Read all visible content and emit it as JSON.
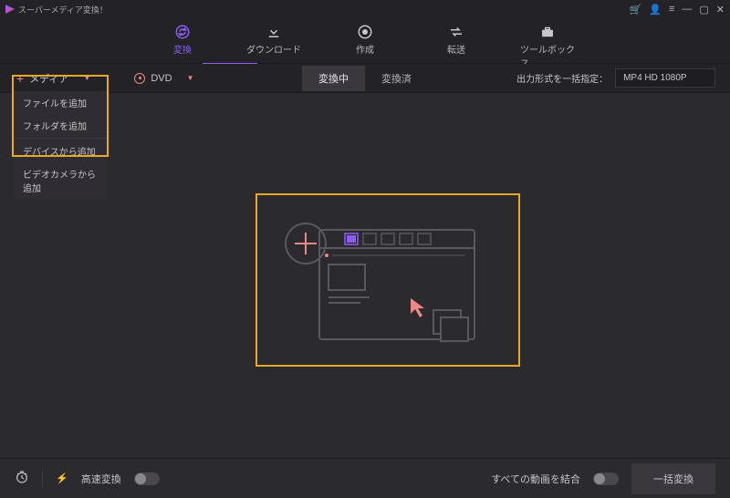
{
  "app": {
    "title": "スーパーメディア変換！"
  },
  "nav": {
    "convert": "変換",
    "download": "ダウンロード",
    "create": "作成",
    "transfer": "転送",
    "toolbox": "ツールボックス"
  },
  "subbar": {
    "media_label": "メディア",
    "dvd_label": "DVD",
    "tab_converting": "変換中",
    "tab_converted": "変換済",
    "output_label": "出力形式を一括指定：",
    "output_value": "MP4 HD 1080P"
  },
  "media_menu": {
    "items": [
      "ファイルを追加",
      "フォルダを追加",
      "デバイスから追加",
      "ビデオカメラから追加"
    ]
  },
  "bottom": {
    "fast_label": "高速変換",
    "merge_label": "すべての動画を結合",
    "batch_label": "一括変換"
  }
}
